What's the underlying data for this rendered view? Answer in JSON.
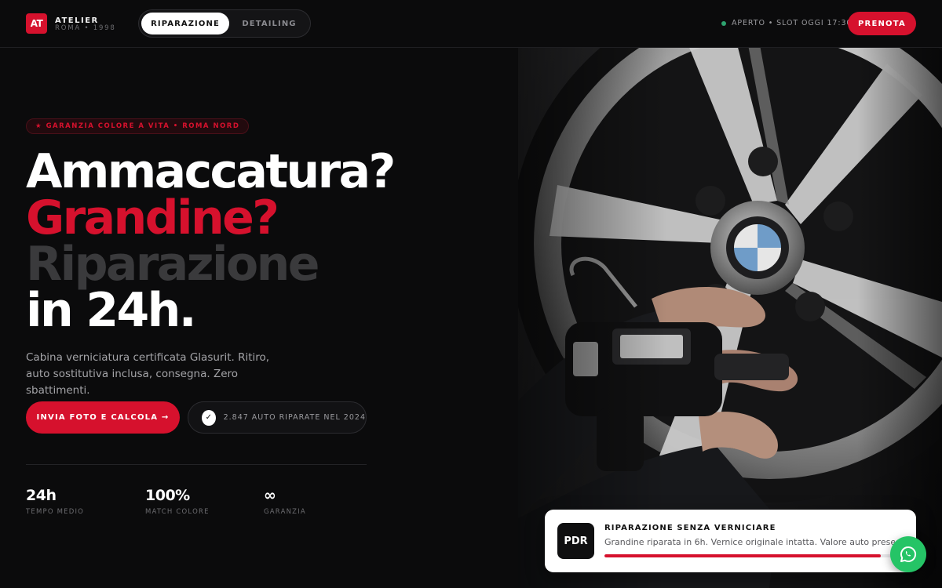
{
  "brand": {
    "logo_text": "AT",
    "name": "ATELIER",
    "tagline": "ROMA • 1998",
    "accent_color": "#d6112d"
  },
  "nav": {
    "tabs": [
      {
        "label": "RIPARAZIONE",
        "active": true
      },
      {
        "label": "DETAILING",
        "active": false
      }
    ],
    "status": "APERTO • SLOT OGGI 17:30",
    "status_color": "#2ea36f",
    "book_label": "PRENOTA"
  },
  "hero": {
    "badge": "★ GARANZIA COLORE A VITA • ROMA NORD",
    "headline": [
      "Ammaccatura?",
      "Grandine?",
      "Riparazione",
      "in 24h."
    ],
    "lead": "Cabina verniciatura certificata Glasurit. Ritiro, auto sostitutiva inclusa, consegna. Zero sbattimenti.",
    "cta_label": "INVIA FOTO E CALCOLA →",
    "proof_icon": "check-icon",
    "proof_text": "2.847 AUTO RIPARATE NEL 2024"
  },
  "stats": [
    {
      "value": "24h",
      "label": "TEMPO MEDIO"
    },
    {
      "value": "100%",
      "label": "MATCH COLORE"
    },
    {
      "value": "∞",
      "label": "GARANZIA"
    }
  ],
  "photo": {
    "icon": "wheel-photo"
  },
  "card": {
    "icon_text": "PDR",
    "title": "RIPARAZIONE SENZA VERNICIARE",
    "text": "Grandine riparata in 6h. Vernice originale intatta. Valore auto preservato.",
    "progress": 0.95
  },
  "chat": {
    "icon": "whatsapp-icon",
    "color": "#25c466"
  }
}
